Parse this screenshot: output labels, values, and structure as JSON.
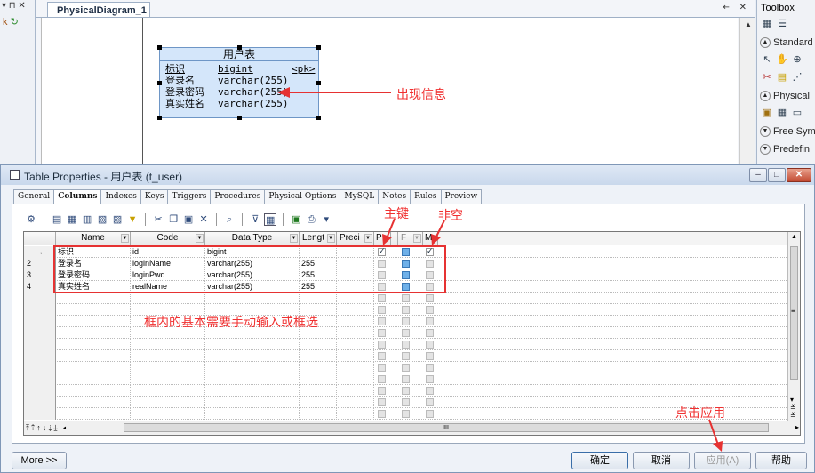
{
  "left_pane": {
    "controls": "▾ ⊓ ✕",
    "icon": "k"
  },
  "diagram": {
    "tab_label": "PhysicalDiagram_1",
    "tab_controls": "⇤ ✕",
    "entity": {
      "title": "用户表",
      "rows": [
        {
          "name": "标识",
          "type": "bigint",
          "key": "<pk>"
        },
        {
          "name": "登录名",
          "type": "varchar(255)",
          "key": ""
        },
        {
          "name": "登录密码",
          "type": "varchar(255)",
          "key": ""
        },
        {
          "name": "真实姓名",
          "type": "varchar(255)",
          "key": ""
        }
      ]
    },
    "annotation": "出现信息"
  },
  "toolbox": {
    "title": "Toolbox",
    "sections": [
      "Standard",
      "Physical",
      "Free Sym",
      "Predefin"
    ]
  },
  "dialog": {
    "title": "Table Properties - 用户表 (t_user)",
    "tabs": [
      "General",
      "Columns",
      "Indexes",
      "Keys",
      "Triggers",
      "Procedures",
      "Physical Options",
      "MySQL",
      "Notes",
      "Rules",
      "Preview"
    ],
    "active_tab": "Columns",
    "columns": [
      "Name",
      "Code",
      "Data Type",
      "Lengt",
      "Preci",
      "P",
      "F",
      "M"
    ],
    "rows": [
      {
        "marker": "→",
        "name": "标识",
        "code": "id",
        "type": "bigint",
        "length": "",
        "p": true,
        "f": true,
        "m": true
      },
      {
        "marker": "2",
        "name": "登录名",
        "code": "loginName",
        "type": "varchar(255)",
        "length": "255",
        "p": false,
        "f": true,
        "m": false
      },
      {
        "marker": "3",
        "name": "登录密码",
        "code": "loginPwd",
        "type": "varchar(255)",
        "length": "255",
        "p": false,
        "f": true,
        "m": false
      },
      {
        "marker": "4",
        "name": "真实姓名",
        "code": "realName",
        "type": "varchar(255)",
        "length": "255",
        "p": false,
        "f": true,
        "m": false
      }
    ],
    "annotations": {
      "primary_key": "主键",
      "not_null": "非空",
      "box_note": "框内的基本需要手动输入或框选",
      "click_apply": "点击应用"
    },
    "buttons": {
      "more": "More >>",
      "ok": "确定",
      "cancel": "取消",
      "apply": "应用(A)",
      "help": "帮助"
    },
    "hscroll_mid": "III"
  }
}
